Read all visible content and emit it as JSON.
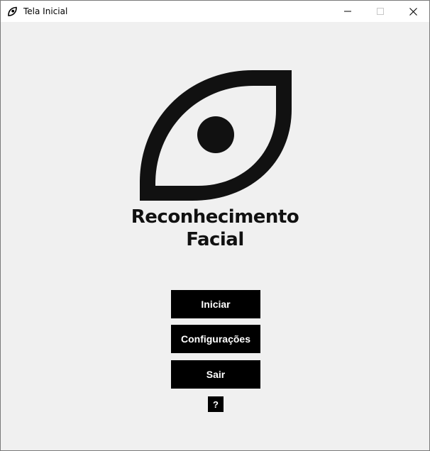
{
  "window": {
    "title": "Tela Inicial"
  },
  "app": {
    "title_line1": "Reconhecimento",
    "title_line2": "Facial",
    "logo_icon": "eye-leaf-icon"
  },
  "buttons": {
    "start": "Iniciar",
    "config": "Configurações",
    "exit": "Sair",
    "help": "?"
  },
  "colors": {
    "background": "#f0f0f0",
    "button_bg": "#000000",
    "button_text": "#ffffff",
    "logo": "#111111"
  }
}
